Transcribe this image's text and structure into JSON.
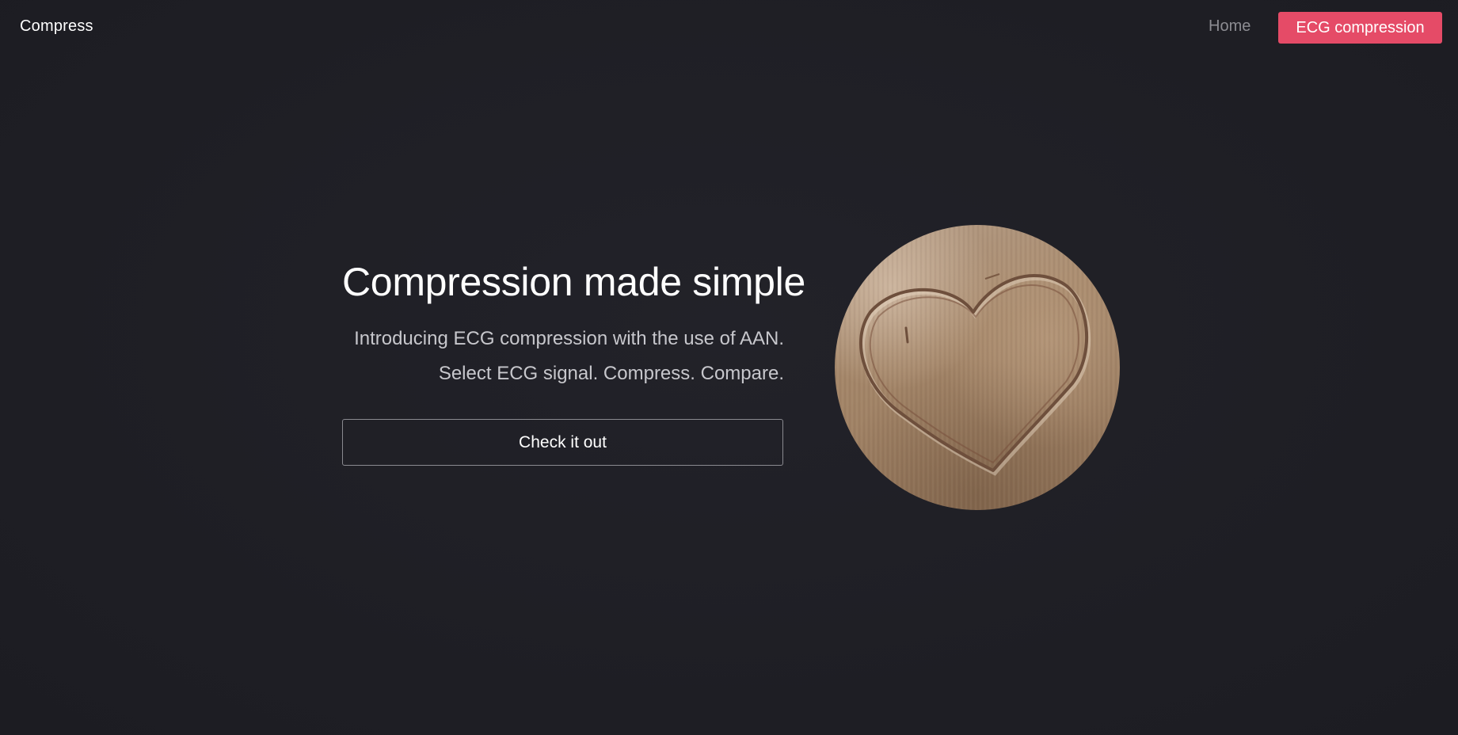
{
  "nav": {
    "brand": "Compress",
    "home_label": "Home",
    "cta_label": "ECG compression"
  },
  "hero": {
    "title": "Compression made simple",
    "subtitle_line1": "Introducing ECG compression with the use of AAN.",
    "subtitle_line2": "Select ECG signal. Compress. Compare.",
    "button_label": "Check it out",
    "image_icon": "heart-carving-photo"
  },
  "colors": {
    "background": "#1f1f25",
    "accent": "#e54b67",
    "muted_text": "#8c8c92"
  }
}
